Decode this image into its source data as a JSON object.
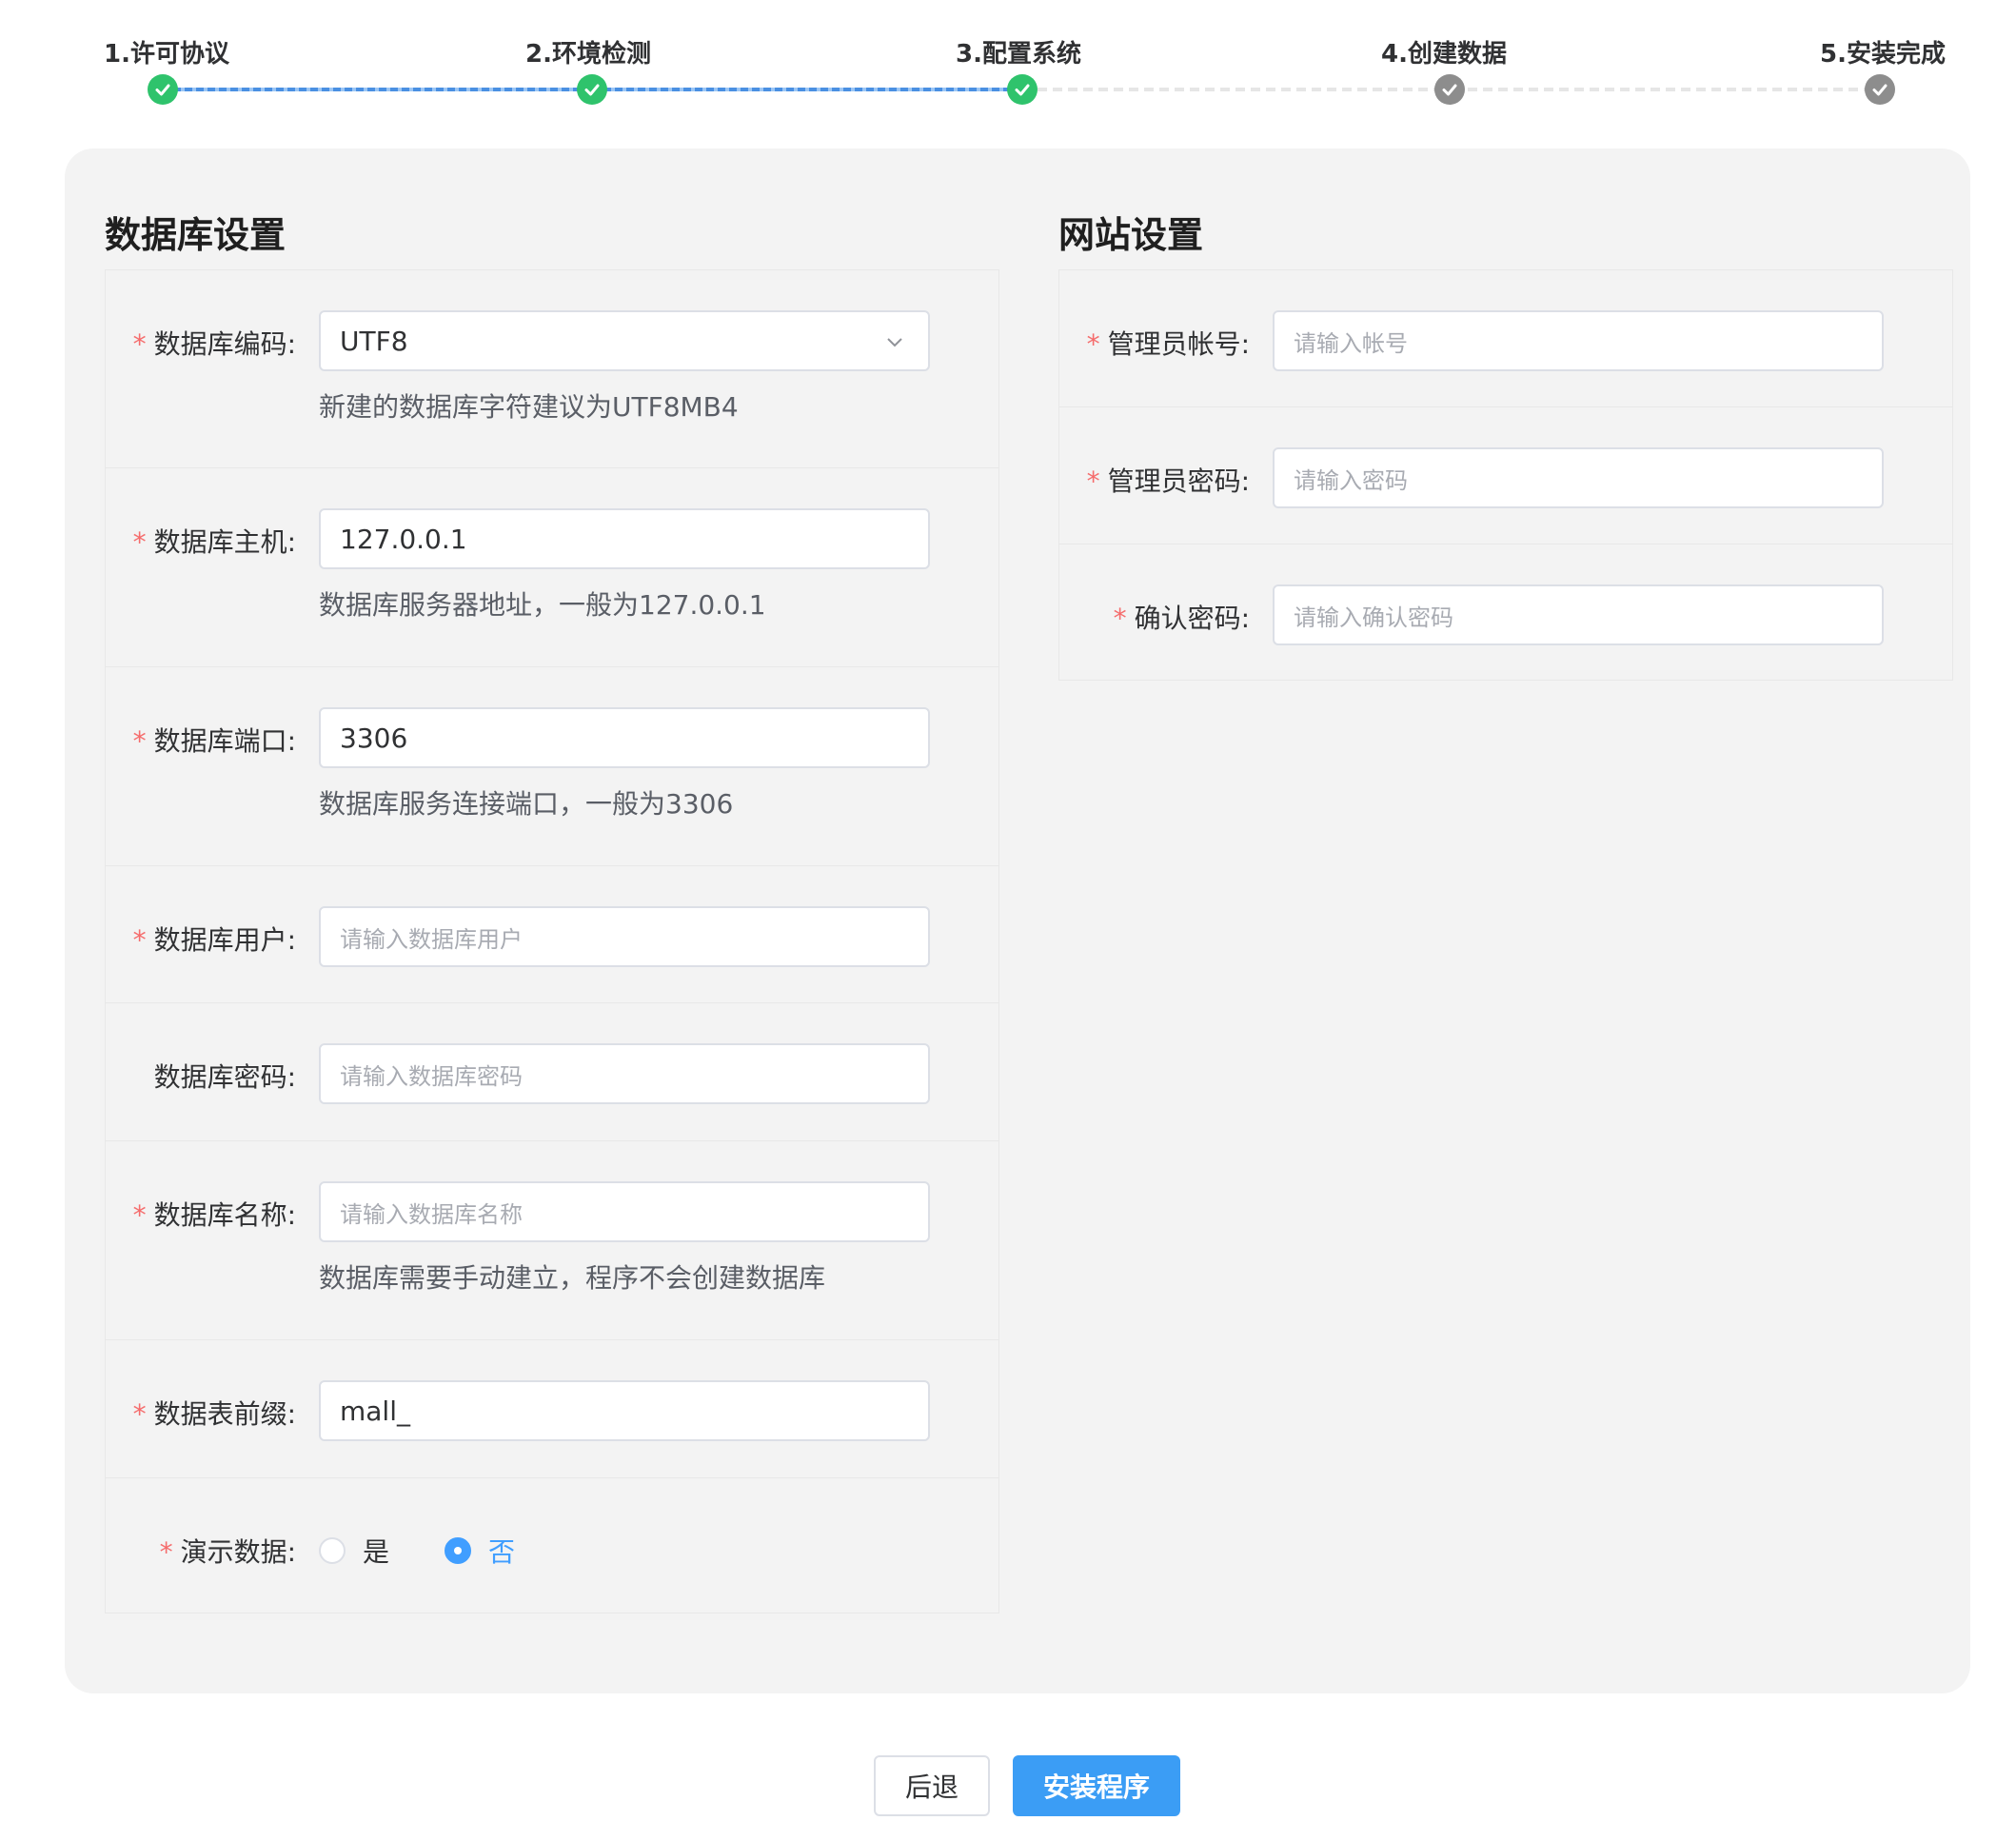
{
  "steps": [
    {
      "label": "1.许可协议",
      "status": "done"
    },
    {
      "label": "2.环境检测",
      "status": "done"
    },
    {
      "label": "3.配置系统",
      "status": "done"
    },
    {
      "label": "4.创建数据",
      "status": "pending"
    },
    {
      "label": "5.安装完成",
      "status": "pending"
    }
  ],
  "db": {
    "title": "数据库设置",
    "charset": {
      "label": "数据库编码:",
      "value": "UTF8",
      "help": "新建的数据库字符建议为UTF8MB4"
    },
    "host": {
      "label": "数据库主机:",
      "value": "127.0.0.1",
      "help": "数据库服务器地址，一般为127.0.0.1"
    },
    "port": {
      "label": "数据库端口:",
      "value": "3306",
      "help": "数据库服务连接端口，一般为3306"
    },
    "user": {
      "label": "数据库用户:",
      "placeholder": "请输入数据库用户"
    },
    "password": {
      "label": "数据库密码:",
      "placeholder": "请输入数据库密码"
    },
    "name": {
      "label": "数据库名称:",
      "placeholder": "请输入数据库名称",
      "help": "数据库需要手动建立，程序不会创建数据库"
    },
    "prefix": {
      "label": "数据表前缀:",
      "value": "mall_"
    },
    "demo": {
      "label": "演示数据:",
      "options": [
        "是",
        "否"
      ],
      "selected": "否"
    }
  },
  "site": {
    "title": "网站设置",
    "admin_account": {
      "label": "管理员帐号:",
      "placeholder": "请输入帐号"
    },
    "admin_password": {
      "label": "管理员密码:",
      "placeholder": "请输入密码"
    },
    "confirm_password": {
      "label": "确认密码:",
      "placeholder": "请输入确认密码"
    }
  },
  "required_mark": "*",
  "buttons": {
    "back": "后退",
    "install": "安装程序"
  },
  "colors": {
    "done": "#2fc36c",
    "pending": "#8d8d8d",
    "primary": "#3b9df5",
    "required": "#f56c6c"
  }
}
